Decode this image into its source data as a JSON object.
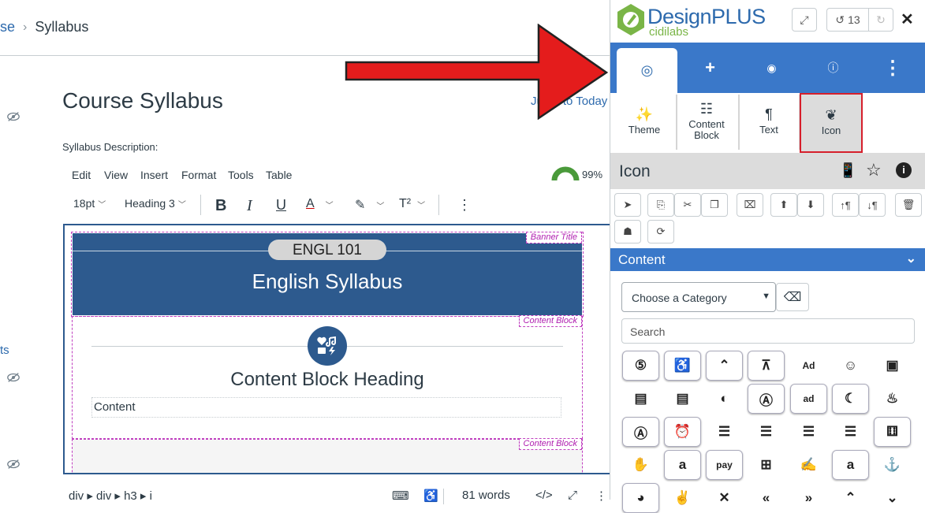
{
  "breadcrumb": {
    "parent": "se",
    "current": "Syllabus"
  },
  "page": {
    "title": "Course Syllabus",
    "jump_link": "Jump to Today",
    "description_label": "Syllabus Description:",
    "left_link": "ts"
  },
  "editor": {
    "menu": [
      "Edit",
      "View",
      "Insert",
      "Format",
      "Tools",
      "Table"
    ],
    "accessibility_pct": "99%",
    "font_size": "18pt",
    "block_style": "Heading 3",
    "status_path": "div ▸ div ▸ h3 ▸ i",
    "word_count": "81 words"
  },
  "content": {
    "banner_label": "Banner Title",
    "pill": "ENGL 101",
    "banner_title": "English Syllabus",
    "block_label": "Content Block",
    "block_heading": "Content Block Heading",
    "block_content": "Content",
    "block2_label": "Content Block"
  },
  "panel": {
    "logo_name": "DesignPLUS",
    "logo_sub": "cidilabs",
    "undo_count": "13",
    "tools": [
      {
        "label": "Theme",
        "icon": "magic-wand-icon"
      },
      {
        "label": "Content\nBlock",
        "icon": "list-icon"
      },
      {
        "label": "Text",
        "icon": "paragraph-icon"
      },
      {
        "label": "Icon",
        "icon": "icon-shapes-icon"
      }
    ],
    "section_title": "Icon",
    "content_bar": "Content",
    "category_placeholder": "Choose a Category",
    "search_placeholder": "Search"
  },
  "icon_grid": [
    [
      "500px-icon",
      "accessible-icon",
      "accusoft-icon",
      "text-height-icon",
      "ad-icon",
      "address-book-icon",
      "address-card-icon"
    ],
    [
      "id-card-icon",
      "id-card-outline-icon",
      "adjust-icon",
      "adobe-icon",
      "ad-outline-icon",
      "aerolinea-icon",
      "air-freshener-icon"
    ],
    [
      "airbnb-icon",
      "alarm-clock-icon",
      "align-center-icon",
      "align-justify-icon",
      "align-left-icon",
      "align-right-icon",
      "allergies-box-icon"
    ],
    [
      "hand-icon",
      "amazon-icon",
      "amazon-pay-icon",
      "ambulance-icon",
      "american-sign-icon",
      "amazon-a-icon",
      "anchor-icon"
    ],
    [
      "android-icon",
      "angellist-icon",
      "angle-x-icon",
      "angle-double-left-icon",
      "angle-double-right-icon",
      "angle-up-icon",
      "angle-down-icon"
    ]
  ],
  "icon_glyphs": [
    [
      "⑤",
      "♿",
      "⌃",
      "⊼",
      "Ad",
      "☺",
      "▣"
    ],
    [
      "▤",
      "▤",
      "◐",
      "Ⓐ",
      "ad",
      "☾",
      "♨"
    ],
    [
      "Ⓐ",
      "⏰",
      "☰",
      "☰",
      "☰",
      "☰",
      "⚅"
    ],
    [
      "✋",
      "a",
      "pay",
      "⊞",
      "✍",
      "a",
      "⚓"
    ],
    [
      "◕",
      "✌",
      "✕",
      "«",
      "»",
      "⌃",
      "⌄"
    ]
  ],
  "icon_bordered": [
    [
      true,
      true,
      true,
      true,
      false,
      false,
      false
    ],
    [
      false,
      false,
      false,
      true,
      true,
      true,
      false
    ],
    [
      true,
      true,
      false,
      false,
      false,
      false,
      true
    ],
    [
      false,
      true,
      true,
      false,
      false,
      true,
      false
    ],
    [
      true,
      false,
      false,
      false,
      false,
      false,
      false
    ]
  ]
}
